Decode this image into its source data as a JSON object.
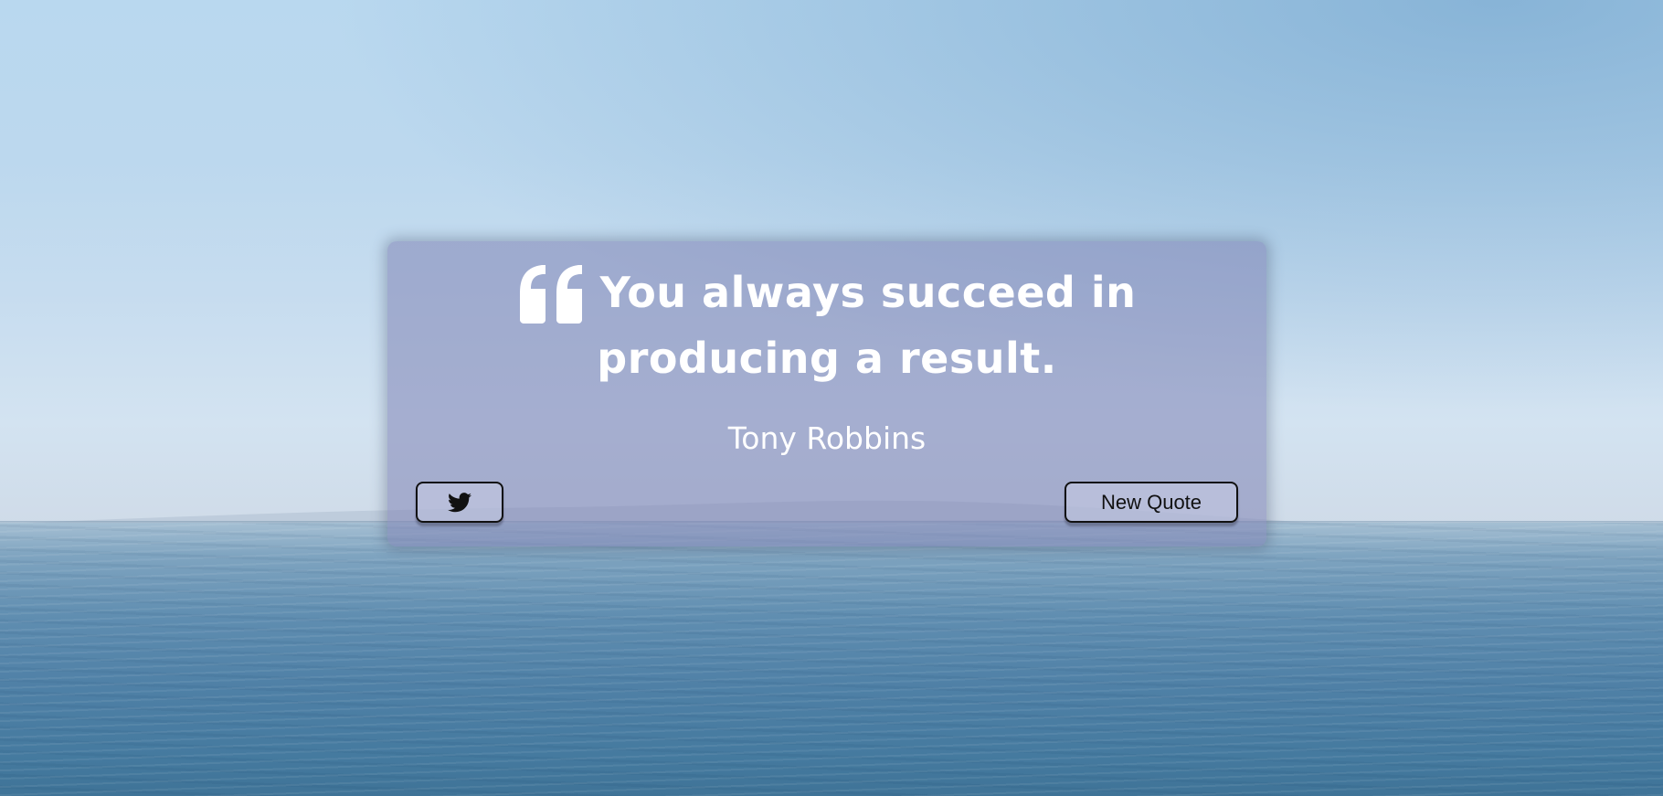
{
  "quote": {
    "text": "You always succeed in producing a result.",
    "author": "Tony Robbins"
  },
  "buttons": {
    "tweet_icon": "twitter-icon",
    "new_quote_label": "New Quote"
  },
  "icons": {
    "quote_mark": "quote-left-icon"
  },
  "colors": {
    "card_background": "#8083b4",
    "text": "#ffffff",
    "button_border": "#111111"
  }
}
